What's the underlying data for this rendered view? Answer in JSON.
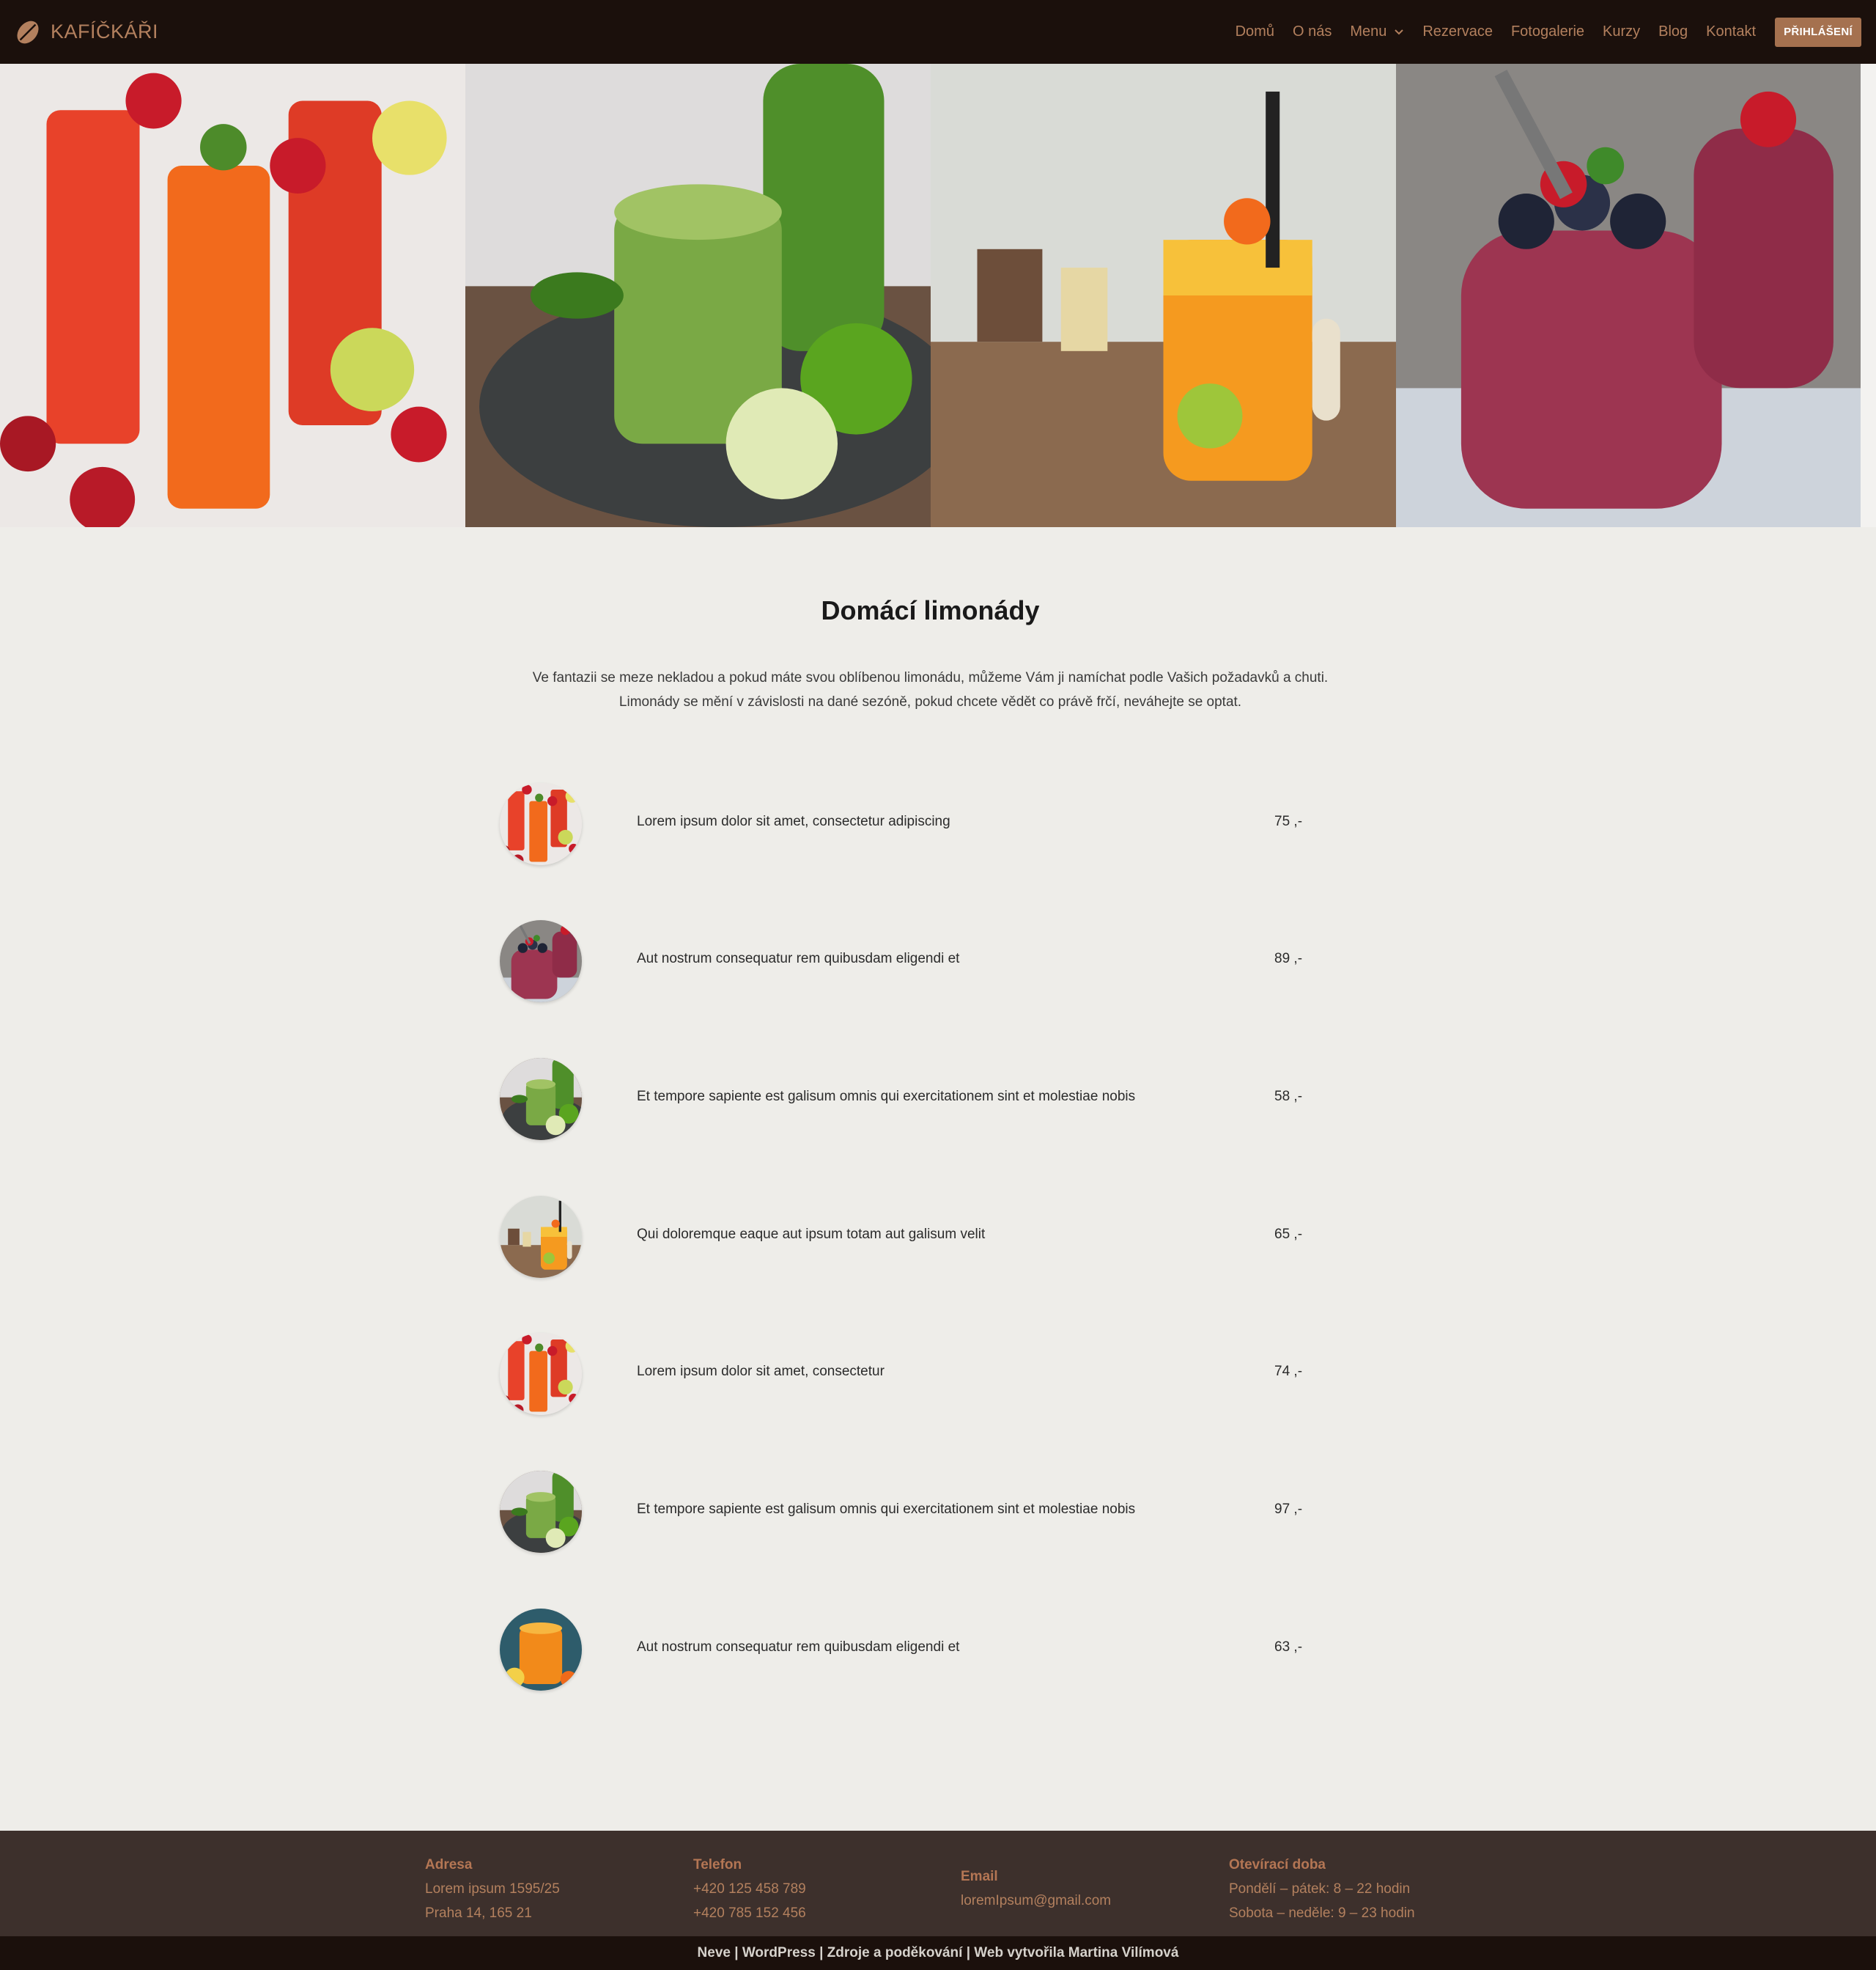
{
  "header": {
    "logo_text": "KAFÍČKÁŘI",
    "nav": [
      "Domů",
      "O nás",
      "Menu",
      "Rezervace",
      "Fotogalerie",
      "Kurzy",
      "Blog",
      "Kontakt"
    ],
    "login_label": "PŘIHLÁŠENÍ"
  },
  "hero": {
    "images": [
      "red-lemonade-photo",
      "green-smoothie-photo",
      "orange-jar-drink-photo",
      "berry-smoothie-photo"
    ]
  },
  "main": {
    "title": "Domácí limonády",
    "intro_line1": "Ve fantazii se meze nekladou a pokud máte svou oblíbenou limonádu, můžeme Vám ji namíchat podle Vašich požadavků a chuti.",
    "intro_line2": "Limonády se mění v závislosti na dané sezóně, pokud chcete vědět co právě frčí, neváhejte se optat."
  },
  "menu_items": [
    {
      "text": "Lorem ipsum dolor sit amet, consectetur adipiscing",
      "price": "75 ,-",
      "thumb": "red-lemonade-thumb"
    },
    {
      "text": "Aut nostrum consequatur rem quibusdam eligendi et",
      "price": "89 ,-",
      "thumb": "berry-smoothie-thumb"
    },
    {
      "text": "Et tempore sapiente est galisum omnis qui exercitationem sint et molestiae nobis",
      "price": "58 ,-",
      "thumb": "green-smoothie-thumb"
    },
    {
      "text": "Qui doloremque eaque aut ipsum totam aut galisum velit",
      "price": "65 ,-",
      "thumb": "orange-jar-thumb"
    },
    {
      "text": "Lorem ipsum dolor sit amet, consectetur",
      "price": "74 ,-",
      "thumb": "red-lemonade-thumb"
    },
    {
      "text": "Et tempore sapiente est galisum omnis qui exercitationem sint et molestiae nobis",
      "price": "97 ,-",
      "thumb": "green-smoothie-thumb"
    },
    {
      "text": "Aut nostrum consequatur rem quibusdam eligendi et",
      "price": "63 ,-",
      "thumb": "orange-juice-thumb"
    }
  ],
  "footer": {
    "address": {
      "heading": "Adresa",
      "line1": "Lorem ipsum 1595/25",
      "line2": "Praha 14, 165 21"
    },
    "phone": {
      "heading": "Telefon",
      "line1": "+420 125 458 789",
      "line2": "+420 785 152 456"
    },
    "email": {
      "heading": "Email",
      "line1": "loremIpsum@gmail.com"
    },
    "hours": {
      "heading": "Otevírací doba",
      "line1": "Pondělí – pátek: 8 – 22 hodin",
      "line2": "Sobota – neděle: 9 – 23 hodin"
    },
    "credits": "Neve | WordPress | Zdroje a poděkování | Web vytvořila Martina Vilímová"
  },
  "colors": {
    "header_bg": "#1b100c",
    "accent": "#b3805e",
    "button_bg": "#a5714f",
    "page_bg": "#eeede9",
    "footer_bg": "#3d302c"
  }
}
